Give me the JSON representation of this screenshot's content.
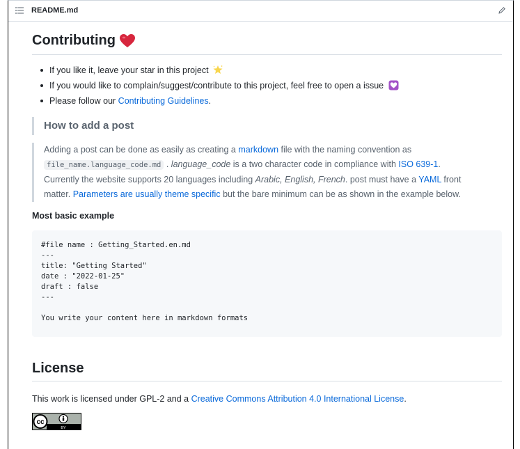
{
  "file_header": {
    "filename": "README.md"
  },
  "contributing": {
    "heading": "Contributing",
    "bullets": [
      {
        "text": "If you like it, leave your star in this project",
        "emoji": "star-icon"
      },
      {
        "text": "If you would like to complain/suggest/contribute to this project, feel free to open a issue",
        "emoji": "heart-box-icon"
      },
      {
        "prefix": "Please follow our ",
        "link": "Contributing Guidelines",
        "suffix": "."
      }
    ]
  },
  "how_to": {
    "title": "How to add a post",
    "p1": "Adding a post can be done as easily as creating a ",
    "markdown_link": "markdown",
    "p2": " file with the naming convention as",
    "code": "file_name.language_code.md",
    "p3": " . ",
    "lang_code_italic": "language_code",
    "p4": " is a two character code in compliance with ",
    "iso_link": "ISO 639-1",
    "p5": ".",
    "p6": "Currently the website supports 20 languages including ",
    "languages_italic": "Arabic, English, French",
    "p7": ". post must have a ",
    "yaml_link": "YAML",
    "p8": " front",
    "p9": "matter. ",
    "params_link": "Parameters are usually theme specific",
    "p10": " but the bare minimum can be as shown in the example below."
  },
  "example": {
    "heading": "Most basic example",
    "code": "#file name : Getting_Started.en.md\n---\ntitle: \"Getting Started\"\ndate : \"2022-01-25\"\ndraft : false\n---\n\nYou write your content here in markdown formats"
  },
  "license": {
    "heading": "License",
    "text": "This work is licensed under GPL-2 and a ",
    "link": "Creative Commons Attribution 4.0 International License",
    "suffix": ".",
    "badge_label": "BY"
  },
  "colors": {
    "link": "#0969da",
    "heart": "#d7263d"
  }
}
